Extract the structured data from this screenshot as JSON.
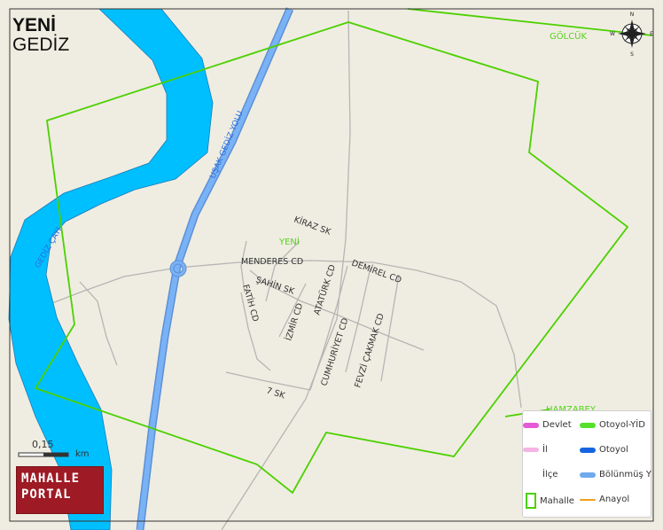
{
  "title": {
    "main": "YENİ",
    "sub": "GEDİZ"
  },
  "compass": {
    "n": "N",
    "s": "S",
    "e": "E",
    "w": "W"
  },
  "neighborhoods": {
    "golcuk": "GÖLCÜK",
    "yeni": "YENİ",
    "hamzabey": "HAMZABEY"
  },
  "water": {
    "river": "GEDİZ ÇAYI"
  },
  "roads": {
    "usak_gediz": "UŞAK GEDİZ YOLU",
    "kiraz": "KİRAZ SK",
    "menderes": "MENDERES CD",
    "demirel": "DEMİREL CD",
    "ataturk": "ATATÜRK CD",
    "sahin": "ŞAHİN SK",
    "fatih": "FATİH CD",
    "izmir": "İZMİR CD",
    "cumhuriyet": "CUMHURİYET CD",
    "fevzi": "FEVZİ ÇAKMAK CD",
    "yedi": "7 SK"
  },
  "scale": {
    "value": "0,15",
    "unit": "km"
  },
  "portal": {
    "line1": "MAHALLE",
    "line2": "PORTAL"
  },
  "legend": {
    "devlet": "Devlet",
    "otoyol_yid": "Otoyol-YİD",
    "il": "İl",
    "otoyol": "Otoyol",
    "ilce": "İlçe",
    "bolunmus": "Bölünmüş Y",
    "mahalle": "Mahalle",
    "anayol": "Anayol"
  },
  "colors": {
    "land": "#efede1",
    "river": "#00bfff",
    "river_edge": "#1a7ab8",
    "highway": "#78acf0",
    "boundary": "#4cd000",
    "road": "#b7b7b7",
    "devlet": "#e55ad6",
    "otoyol_yid": "#55e02a",
    "il": "#f5b4e4",
    "otoyol": "#1565e0",
    "bolunmus": "#70aaee",
    "anayol": "#f0a020",
    "label_green": "#57d31c",
    "label_blue": "#2b7ce8",
    "portal": "#9e1a24"
  }
}
